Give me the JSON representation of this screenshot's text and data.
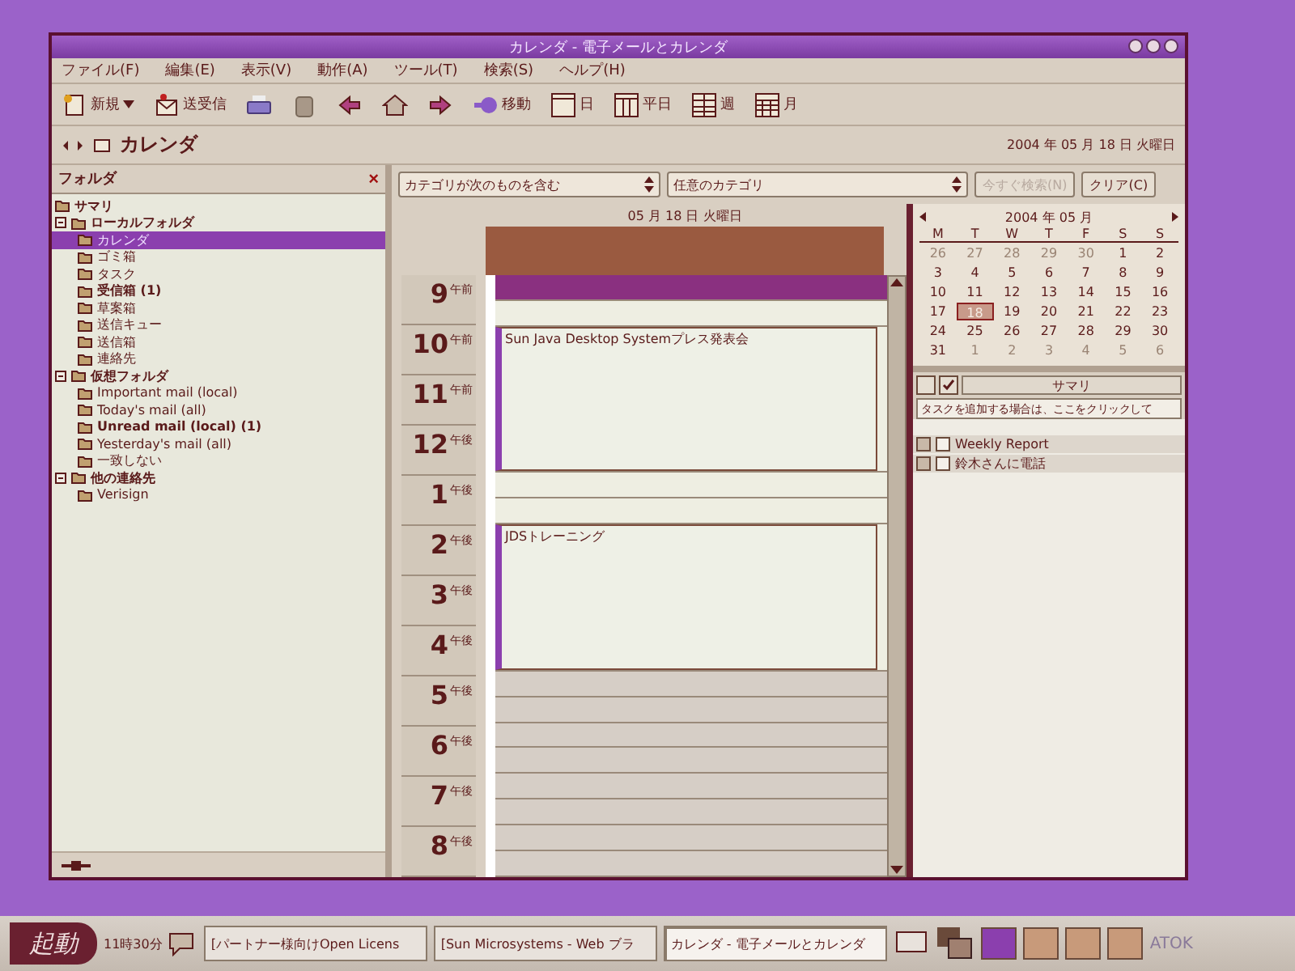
{
  "window": {
    "title": "カレンダ - 電子メールとカレンダ"
  },
  "menu": [
    "ファイル(F)",
    "編集(E)",
    "表示(V)",
    "動作(A)",
    "ツール(T)",
    "検索(S)",
    "ヘルプ(H)"
  ],
  "toolbar": [
    {
      "kind": "new",
      "label": "新規"
    },
    {
      "kind": "sendreceive",
      "label": "送受信"
    },
    {
      "kind": "print"
    },
    {
      "kind": "delete"
    },
    {
      "kind": "back"
    },
    {
      "kind": "today"
    },
    {
      "kind": "forward"
    },
    {
      "kind": "goto",
      "label": "移動"
    },
    {
      "kind": "day",
      "label": "日"
    },
    {
      "kind": "workweek",
      "label": "平日"
    },
    {
      "kind": "week",
      "label": "週"
    },
    {
      "kind": "month",
      "label": "月"
    }
  ],
  "header": {
    "title": "カレンダ",
    "date": "2004 年 05 月 18 日 火曜日"
  },
  "sidebar": {
    "title": "フォルダ",
    "close": "×",
    "items": [
      {
        "label": "サマリ",
        "selected": false
      },
      {
        "label": "ローカルフォルダ",
        "selected": false,
        "expanded": true,
        "children": [
          {
            "label": "カレンダ",
            "selected": true,
            "unread": false
          },
          {
            "label": "ゴミ箱",
            "selected": false,
            "unread": false
          },
          {
            "label": "タスク",
            "selected": false,
            "unread": false
          },
          {
            "label": "受信箱 (1)",
            "selected": false,
            "unread": true
          },
          {
            "label": "草案箱",
            "selected": false,
            "unread": false
          },
          {
            "label": "送信キュー",
            "selected": false,
            "unread": false
          },
          {
            "label": "送信箱",
            "selected": false,
            "unread": false
          },
          {
            "label": "連絡先",
            "selected": false,
            "unread": false
          }
        ]
      },
      {
        "label": "仮想フォルダ",
        "selected": false,
        "expanded": true,
        "children": [
          {
            "label": "Important mail (local)",
            "selected": false,
            "unread": false
          },
          {
            "label": "Today's mail (all)",
            "selected": false,
            "unread": false
          },
          {
            "label": "Unread mail (local) (1)",
            "selected": false,
            "unread": true
          },
          {
            "label": "Yesterday's mail (all)",
            "selected": false,
            "unread": false
          },
          {
            "label": "一致しない",
            "selected": false,
            "unread": false
          }
        ]
      },
      {
        "label": "他の連絡先",
        "selected": false,
        "expanded": true,
        "children": [
          {
            "label": "Verisign",
            "selected": false,
            "unread": false
          }
        ]
      }
    ]
  },
  "search": {
    "category_filter": "カテゴリが次のものを含む",
    "category": "任意のカテゴリ",
    "search_button": {
      "label": "今すぐ検索(N)",
      "disabled": true
    },
    "clear_button": {
      "label": "クリア(C)",
      "disabled": false
    }
  },
  "day_view": {
    "date": "05 月 18 日 火曜日",
    "hours": [
      {
        "hour": "9",
        "period": "午前"
      },
      {
        "hour": "10",
        "period": "午前"
      },
      {
        "hour": "11",
        "period": "午前"
      },
      {
        "hour": "12",
        "period": "午後"
      },
      {
        "hour": "1",
        "period": "午後"
      },
      {
        "hour": "2",
        "period": "午後"
      },
      {
        "hour": "3",
        "period": "午後"
      },
      {
        "hour": "4",
        "period": "午後"
      },
      {
        "hour": "5",
        "period": "午後"
      },
      {
        "hour": "6",
        "period": "午後"
      },
      {
        "hour": "7",
        "period": "午後"
      },
      {
        "hour": "8",
        "period": "午後"
      }
    ],
    "slots": [
      {
        "kind": "free",
        "selected": true,
        "working": true
      },
      {
        "kind": "free",
        "selected": false,
        "working": true
      },
      {
        "kind": "event",
        "title": "Sun Java Desktop Systemプレス発表会"
      },
      {
        "kind": "busy"
      },
      {
        "kind": "busy"
      },
      {
        "kind": "busy"
      },
      {
        "kind": "busy"
      },
      {
        "kind": "busy"
      },
      {
        "kind": "free",
        "selected": false,
        "working": true
      },
      {
        "kind": "free",
        "selected": false,
        "working": true
      },
      {
        "kind": "event",
        "title": "JDSトレーニング"
      },
      {
        "kind": "busy"
      },
      {
        "kind": "busy"
      },
      {
        "kind": "busy"
      },
      {
        "kind": "busy"
      },
      {
        "kind": "busy"
      },
      {
        "kind": "free",
        "selected": false,
        "working": false
      },
      {
        "kind": "free",
        "selected": false,
        "working": false
      },
      {
        "kind": "free",
        "selected": false,
        "working": false
      },
      {
        "kind": "free",
        "selected": false,
        "working": false
      },
      {
        "kind": "free",
        "selected": false,
        "working": false
      },
      {
        "kind": "free",
        "selected": false,
        "working": false
      },
      {
        "kind": "free",
        "selected": false,
        "working": false
      },
      {
        "kind": "free",
        "selected": false,
        "working": false
      }
    ]
  },
  "mini_calendar": {
    "title": "2004 年 05 月",
    "weekdays": [
      "M",
      "T",
      "W",
      "T",
      "F",
      "S",
      "S"
    ],
    "weeks": [
      [
        {
          "day": "26",
          "other_month": true,
          "today": false
        },
        {
          "day": "27",
          "other_month": true,
          "today": false
        },
        {
          "day": "28",
          "other_month": true,
          "today": false
        },
        {
          "day": "29",
          "other_month": true,
          "today": false
        },
        {
          "day": "30",
          "other_month": true,
          "today": false
        },
        {
          "day": "1",
          "other_month": false,
          "today": false
        },
        {
          "day": "2",
          "other_month": false,
          "today": false
        }
      ],
      [
        {
          "day": "3",
          "other_month": false,
          "today": false
        },
        {
          "day": "4",
          "other_month": false,
          "today": false
        },
        {
          "day": "5",
          "other_month": false,
          "today": false
        },
        {
          "day": "6",
          "other_month": false,
          "today": false
        },
        {
          "day": "7",
          "other_month": false,
          "today": false
        },
        {
          "day": "8",
          "other_month": false,
          "today": false
        },
        {
          "day": "9",
          "other_month": false,
          "today": false
        }
      ],
      [
        {
          "day": "10",
          "other_month": false,
          "today": false
        },
        {
          "day": "11",
          "other_month": false,
          "today": false
        },
        {
          "day": "12",
          "other_month": false,
          "today": false
        },
        {
          "day": "13",
          "other_month": false,
          "today": false
        },
        {
          "day": "14",
          "other_month": false,
          "today": false
        },
        {
          "day": "15",
          "other_month": false,
          "today": false
        },
        {
          "day": "16",
          "other_month": false,
          "today": false
        }
      ],
      [
        {
          "day": "17",
          "other_month": false,
          "today": false
        },
        {
          "day": "18",
          "other_month": false,
          "today": true
        },
        {
          "day": "19",
          "other_month": false,
          "today": false
        },
        {
          "day": "20",
          "other_month": false,
          "today": false
        },
        {
          "day": "21",
          "other_month": false,
          "today": false
        },
        {
          "day": "22",
          "other_month": false,
          "today": false
        },
        {
          "day": "23",
          "other_month": false,
          "today": false
        }
      ],
      [
        {
          "day": "24",
          "other_month": false,
          "today": false
        },
        {
          "day": "25",
          "other_month": false,
          "today": false
        },
        {
          "day": "26",
          "other_month": false,
          "today": false
        },
        {
          "day": "27",
          "other_month": false,
          "today": false
        },
        {
          "day": "28",
          "other_month": false,
          "today": false
        },
        {
          "day": "29",
          "other_month": false,
          "today": false
        },
        {
          "day": "30",
          "other_month": false,
          "today": false
        }
      ],
      [
        {
          "day": "31",
          "other_month": false,
          "today": false
        },
        {
          "day": "1",
          "other_month": true,
          "today": false
        },
        {
          "day": "2",
          "other_month": true,
          "today": false
        },
        {
          "day": "3",
          "other_month": true,
          "today": false
        },
        {
          "day": "4",
          "other_month": true,
          "today": false
        },
        {
          "day": "5",
          "other_month": true,
          "today": false
        },
        {
          "day": "6",
          "other_month": true,
          "today": false
        }
      ]
    ]
  },
  "tasks": {
    "column": "サマリ",
    "placeholder": "タスクを追加する場合は、ここをクリックして",
    "items": [
      {
        "title": "Weekly Report",
        "done": false
      },
      {
        "title": "鈴木さんに電話",
        "done": false
      }
    ]
  },
  "taskbar": {
    "start": "起動",
    "clock": "11時30分",
    "windows": [
      {
        "label": "[パートナー様向けOpen Licens",
        "selected": false
      },
      {
        "label": "[Sun Microsystems - Web ブラ",
        "selected": false
      },
      {
        "label": "カレンダ - 電子メールとカレンダ",
        "selected": true
      }
    ],
    "workspaces": [
      {
        "selected": true
      },
      {
        "selected": false
      },
      {
        "selected": false
      },
      {
        "selected": false
      }
    ],
    "input_method": "ATOK"
  }
}
